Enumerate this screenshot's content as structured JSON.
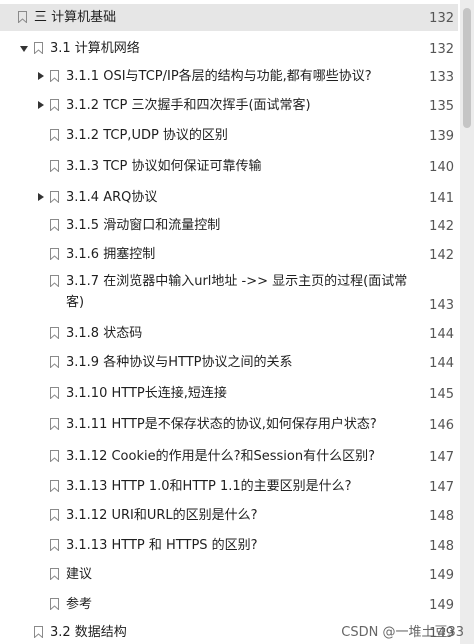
{
  "toc": {
    "items": [
      {
        "label": "三 计算机基础",
        "page": "132",
        "level": 0,
        "expand": "none",
        "selected": true
      },
      {
        "label": "3.1 计算机网络",
        "page": "132",
        "level": 1,
        "expand": "down",
        "selected": false
      },
      {
        "label": "3.1.1 OSI与TCP/IP各层的结构与功能,都有哪些协议?",
        "page": "133",
        "level": 2,
        "expand": "right",
        "selected": false
      },
      {
        "label": "3.1.2 TCP 三次握手和四次挥手(面试常客)",
        "page": "135",
        "level": 2,
        "expand": "right",
        "selected": false
      },
      {
        "label": "3.1.2 TCP,UDP 协议的区别",
        "page": "139",
        "level": 2,
        "expand": "none",
        "selected": false
      },
      {
        "label": "3.1.3 TCP 协议如何保证可靠传输",
        "page": "140",
        "level": 2,
        "expand": "none",
        "selected": false
      },
      {
        "label": "3.1.4 ARQ协议",
        "page": "141",
        "level": 2,
        "expand": "right",
        "selected": false
      },
      {
        "label": "3.1.5 滑动窗口和流量控制",
        "page": "142",
        "level": 2,
        "expand": "none",
        "selected": false
      },
      {
        "label": "3.1.6 拥塞控制",
        "page": "142",
        "level": 2,
        "expand": "none",
        "selected": false
      },
      {
        "label": "3.1.7 在浏览器中输入url地址 ->> 显示主页的过程(面试常客)",
        "page": "143",
        "level": 2,
        "expand": "none",
        "selected": false
      },
      {
        "label": "3.1.8 状态码",
        "page": "144",
        "level": 2,
        "expand": "none",
        "selected": false
      },
      {
        "label": "3.1.9 各种协议与HTTP协议之间的关系",
        "page": "144",
        "level": 2,
        "expand": "none",
        "selected": false
      },
      {
        "label": "3.1.10 HTTP长连接,短连接",
        "page": "145",
        "level": 2,
        "expand": "none",
        "selected": false
      },
      {
        "label": "3.1.11 HTTP是不保存状态的协议,如何保存用户状态?",
        "page": "146",
        "level": 2,
        "expand": "none",
        "selected": false
      },
      {
        "label": "3.1.12 Cookie的作用是什么?和Session有什么区别?",
        "page": "147",
        "level": 2,
        "expand": "none",
        "selected": false
      },
      {
        "label": "3.1.13 HTTP 1.0和HTTP 1.1的主要区别是什么?",
        "page": "147",
        "level": 2,
        "expand": "none",
        "selected": false
      },
      {
        "label": "3.1.12 URI和URL的区别是什么?",
        "page": "148",
        "level": 2,
        "expand": "none",
        "selected": false
      },
      {
        "label": "3.1.13 HTTP 和 HTTPS 的区别?",
        "page": "148",
        "level": 2,
        "expand": "none",
        "selected": false
      },
      {
        "label": "建议",
        "page": "149",
        "level": 2,
        "expand": "none",
        "selected": false
      },
      {
        "label": "参考",
        "page": "149",
        "level": 2,
        "expand": "none",
        "selected": false
      },
      {
        "label": "3.2 数据结构",
        "page": "149",
        "level": 1,
        "expand": "none",
        "selected": false
      }
    ]
  },
  "watermark": "CSDN @一堆土豆33",
  "colors": {
    "selected_bg": "#e6e6e6",
    "bookmark": "#8a8a8a",
    "text": "#1f1f1f",
    "page_num": "#555555"
  },
  "icons": {
    "bookmark": "bookmark-icon",
    "expand_right": "expand-right-icon",
    "expand_down": "expand-down-icon"
  }
}
